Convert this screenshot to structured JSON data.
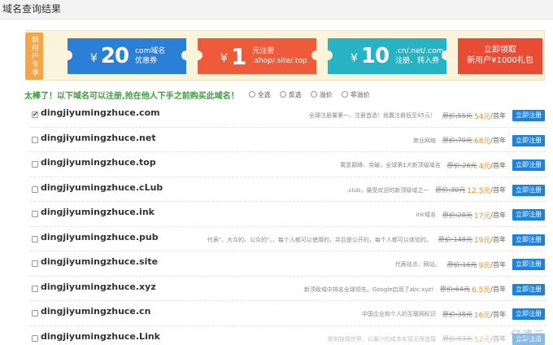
{
  "header": {
    "title": "域名查询结果"
  },
  "promo": {
    "new_user_tag": "新用户专享",
    "coupons": [
      {
        "currency": "¥",
        "amount": "20",
        "line1": "com域名",
        "line2": "优惠券",
        "color": "#2b7fd6"
      },
      {
        "currency": "¥",
        "amount": "1",
        "line1": "元注册",
        "line2": ".shop/.site/.top",
        "color": "#ef5b3a"
      },
      {
        "currency": "¥",
        "amount": "10",
        "line1": ".cn/.net/.com",
        "line2": "注册、转入券",
        "color": "#28b3c5"
      }
    ],
    "claim": {
      "line1": "立即领取",
      "line2": "新用户¥1000礼包"
    }
  },
  "notice": "太棒了！以下域名可以注册,抢在他人下手之前购买此域名！",
  "filters": [
    "全选",
    "反选",
    "溢价",
    "非溢价"
  ],
  "unit_label": "/首年",
  "register_label": "立即注册",
  "domains": [
    {
      "name": "dingjiyumingzhuce.com",
      "info": "全球注册量第一、注册首选！就赢注册低至45元！",
      "orig": "原价:55元",
      "price": "54元",
      "checked": "✔"
    },
    {
      "name": "dingjiyumingzhuce.net",
      "info": "商业网络",
      "orig": "原价:70元",
      "price": "68元",
      "checked": ""
    },
    {
      "name": "dingjiyumingzhuce.top",
      "info": "寓意巅峰、突破，全球第1大新顶级域名",
      "orig": "原价:26元",
      "price": "4元",
      "checked": ""
    },
    {
      "name": "dingjiyumingzhuce.cLub",
      "info": ".club，最受欢迎的新顶级域之一",
      "orig": "原价:30元",
      "price": "12.5元",
      "checked": ""
    },
    {
      "name": "dingjiyumingzhuce.ink",
      "info": "ink域名",
      "orig": "原价:28元",
      "price": "17元",
      "checked": ""
    },
    {
      "name": "dingjiyumingzhuce.pub",
      "info": "代表\"、大众的、公众的\"。，每个人都可以使用的，并且是公开的，每个人都可以体验的。",
      "orig": "原价:148元",
      "price": "19元",
      "checked": ""
    },
    {
      "name": "dingjiyumingzhuce.site",
      "info": "代表站点、网站。",
      "orig": "原价:16元",
      "price": "9元",
      "checked": ""
    },
    {
      "name": "dingjiyumingzhuce.xyz",
      "info": "新顶级域中排名全球领先，Google启用了abc.xyz!",
      "orig": "原价:64元",
      "price": "6.5元",
      "checked": ""
    },
    {
      "name": "dingjiyumingzhuce.cn",
      "info": "中国企业和个人的互联网标识",
      "orig": "原价:38元",
      "price": "16元",
      "checked": ""
    },
    {
      "name": "dingjiyumingzhuce.Link",
      "info": "即刻链接世界、以最少的成本实现无限连接",
      "orig": "原价:53元",
      "price": "52元",
      "checked": ""
    }
  ],
  "watermark": "亿速云"
}
